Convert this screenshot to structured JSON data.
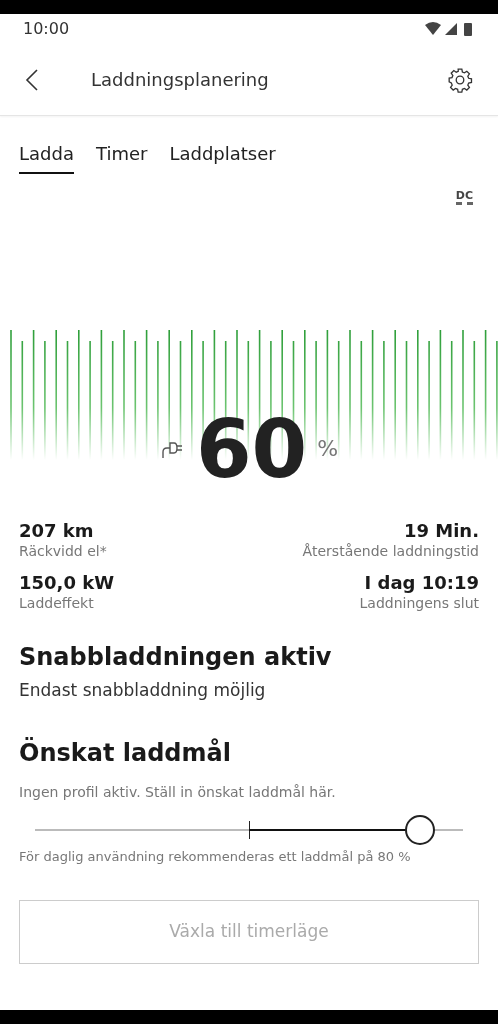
{
  "status_bar": {
    "time": "10:00"
  },
  "app_bar": {
    "title": "Laddningsplanering"
  },
  "tabs": [
    {
      "label": "Ladda",
      "selected": true
    },
    {
      "label": "Timer",
      "selected": false
    },
    {
      "label": "Laddplatser",
      "selected": false
    }
  ],
  "current_type": "DC",
  "charge": {
    "value": "60",
    "unit": "%"
  },
  "stats": [
    {
      "value": "207 km",
      "label": "Räckvidd el*"
    },
    {
      "value": "19 Min.",
      "label": "Återstående laddningstid"
    },
    {
      "value": "150,0 kW",
      "label": "Laddeffekt"
    },
    {
      "value": "I dag 10:19",
      "label": "Laddningens slut"
    }
  ],
  "fast_charging": {
    "title": "Snabbladdningen aktiv",
    "text": "Endast snabbladdning möjlig"
  },
  "target": {
    "title": "Önskat laddmål",
    "hint": "Ingen profil aktiv. Ställ in önskat laddmål här.",
    "level": 0.9,
    "note": "För daglig användning rekommenderas ett laddmål på 80 %"
  },
  "button": {
    "label": "Växla till timerläge",
    "disabled": true
  }
}
